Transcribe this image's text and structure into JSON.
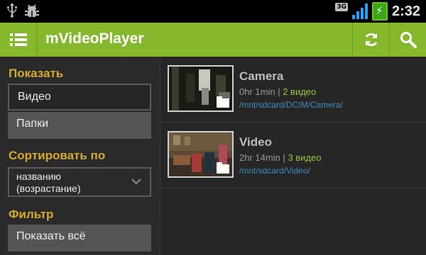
{
  "status_bar": {
    "icons_left": [
      "usb-icon",
      "bug-icon"
    ],
    "network_type": "3G",
    "time": "2:32",
    "colors": {
      "signal": "#2aa0ff",
      "battery": "#3aa616"
    }
  },
  "action_bar": {
    "title": "mVideoPlayer",
    "background": "#86b82e",
    "buttons": [
      "menu-icon",
      "refresh-icon",
      "search-icon"
    ]
  },
  "sidebar": {
    "show_title": "Показать",
    "show_options": [
      {
        "label": "Видео",
        "selected": true
      },
      {
        "label": "Папки",
        "selected": false
      }
    ],
    "sort_title": "Сортировать по",
    "sort_value_line1": "названию",
    "sort_value_line2": "(возрастание)",
    "filter_title": "Фильтр",
    "filter_value": "Показать всё"
  },
  "folders": [
    {
      "name": "Camera",
      "duration": "0hr 1min",
      "count": "2 видео",
      "path": "/mnt/sdcard/DCIM/Camera/"
    },
    {
      "name": "Video",
      "duration": "2hr 14min",
      "count": "3 видео",
      "path": "/mnt/sdcard/Video/"
    }
  ]
}
